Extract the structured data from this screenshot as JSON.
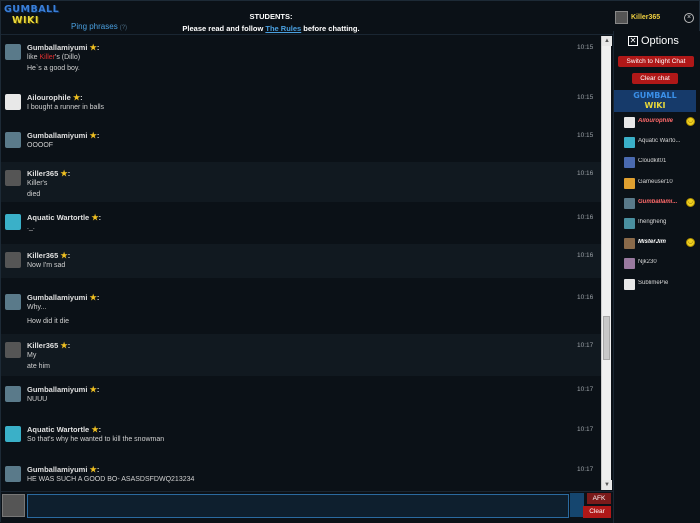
{
  "header": {
    "logo_line1": "GUMBALL",
    "logo_line2": "WIKI",
    "ping_label": "Ping phrases",
    "ping_hint": "(?)",
    "notice_title": "STUDENTS:",
    "notice_prefix": "Please read and follow ",
    "notice_link": "The Rules",
    "notice_suffix": " before chatting."
  },
  "current_user": {
    "name": "Killer365",
    "close_label": "×"
  },
  "messages": [
    {
      "user": "Gumballamiyumi",
      "time": "10:15",
      "lines": [
        "like Killer's (Dillo)",
        "He`s a good boy."
      ],
      "highlight": "Killer",
      "avatar_color": "#5a7a8a"
    },
    {
      "user": "Ailourophile",
      "time": "10:15",
      "lines": [
        "I bought a runner in balls"
      ],
      "avatar_color": "#e8e8e8"
    },
    {
      "user": "Gumballamiyumi",
      "time": "10:15",
      "lines": [
        "OOOOF"
      ],
      "avatar_color": "#5a7a8a"
    },
    {
      "user": "Killer365",
      "time": "10:16",
      "lines": [
        "Killer's",
        "died"
      ],
      "avatar_color": "#555555"
    },
    {
      "user": "Aquatic Wartortle",
      "time": "10:16",
      "lines": [
        "._."
      ],
      "avatar_color": "#3ab0c8"
    },
    {
      "user": "Killer365",
      "time": "10:16",
      "lines": [
        "Now I'm sad"
      ],
      "avatar_color": "#555555"
    },
    {
      "user": "Gumballamiyumi",
      "time": "10:16",
      "lines": [
        "Why...",
        "How did it die"
      ],
      "avatar_color": "#5a7a8a"
    },
    {
      "user": "Killer365",
      "time": "10:17",
      "lines": [
        "My",
        "ate him"
      ],
      "avatar_color": "#555555"
    },
    {
      "user": "Gumballamiyumi",
      "time": "10:17",
      "lines": [
        "NUUU"
      ],
      "avatar_color": "#5a7a8a"
    },
    {
      "user": "Aquatic Wartortle",
      "time": "10:17",
      "lines": [
        "So that's why he wanted to kill the snowman"
      ],
      "avatar_color": "#3ab0c8"
    },
    {
      "user": "Gumballamiyumi",
      "time": "10:17",
      "lines": [
        "HE WAS SUCH A GOOD BO- ASASDSFDWQ213234"
      ],
      "avatar_color": "#5a7a8a"
    }
  ],
  "input": {
    "value": "",
    "placeholder": ""
  },
  "buttons": {
    "afk": "AFK",
    "clear": "Clear"
  },
  "sidebar": {
    "options_label": "Options",
    "night_chat": "Switch to Night Chat",
    "clear_chat": "Clear chat",
    "logo_line1": "GUMBALL",
    "logo_line2": "WIKI",
    "users": [
      {
        "name": "Ailourophile",
        "role": "mod",
        "away": true,
        "avatar_color": "#e8e8e8"
      },
      {
        "name": "Aquatic Warto...",
        "role": "user",
        "away": false,
        "avatar_color": "#3ab0c8"
      },
      {
        "name": "Cloudkit01",
        "role": "user",
        "away": false,
        "avatar_color": "#4a6ab0"
      },
      {
        "name": "Gameuser10",
        "role": "user",
        "away": false,
        "avatar_color": "#e0a030"
      },
      {
        "name": "Gumballami...",
        "role": "mod",
        "away": true,
        "avatar_color": "#5a7a8a"
      },
      {
        "name": "Ihengheng",
        "role": "user",
        "away": false,
        "avatar_color": "#4a90a0"
      },
      {
        "name": "MisterJim",
        "role": "admin",
        "away": true,
        "avatar_color": "#8a6a4a"
      },
      {
        "name": "Njk230",
        "role": "user",
        "away": false,
        "avatar_color": "#9a7aa0"
      },
      {
        "name": "SublimePie",
        "role": "user",
        "away": false,
        "avatar_color": "#e8e8e8"
      }
    ]
  },
  "colors": {
    "background": "#0b1117",
    "accent_red": "#b01818",
    "link_blue": "#4aa0e0",
    "star": "#f0c020"
  }
}
